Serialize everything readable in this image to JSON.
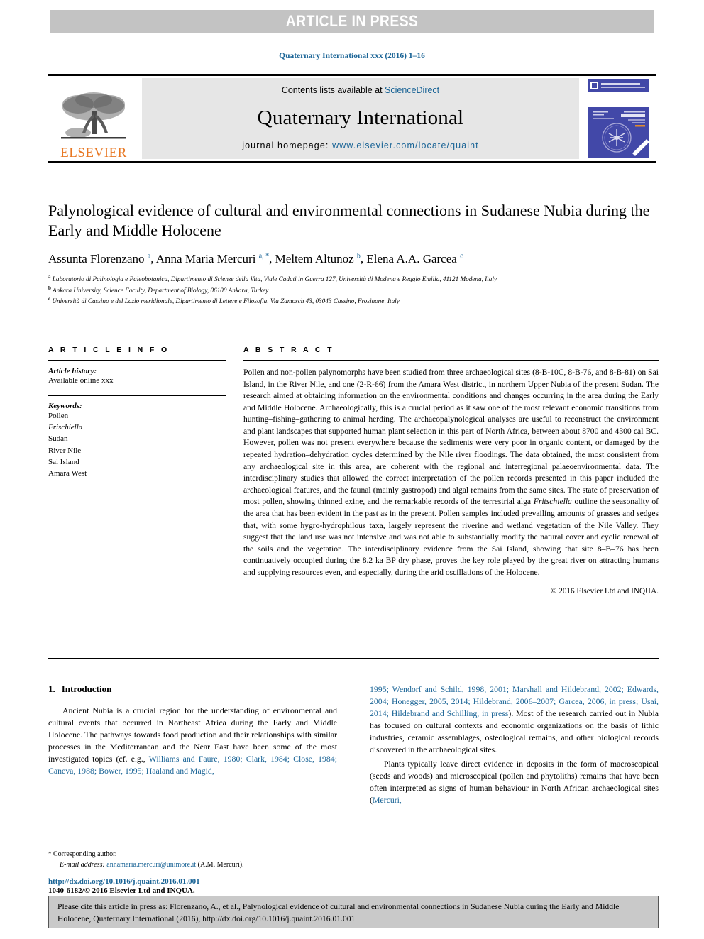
{
  "banner": {
    "label": "ARTICLE IN PRESS"
  },
  "journal_ref": "Quaternary International xxx (2016) 1–16",
  "masthead": {
    "contents_prefix": "Contents lists available at ",
    "sciencedirect": "ScienceDirect",
    "journal_name": "Quaternary International",
    "homepage_prefix": "journal homepage: ",
    "homepage_url": "www.elsevier.com/locate/quaint",
    "publisher": "ELSEVIER",
    "publisher_color": "#E87722",
    "link_color": "#1a6496",
    "cover_icon": "journal-cover-thumbnail",
    "logo_icon": "elsevier-tree-logo"
  },
  "article": {
    "title": "Palynological evidence of cultural and environmental connections in Sudanese Nubia during the Early and Middle Holocene",
    "authors_html": "Assunta Florenzano <sup>a</sup>, Anna Maria Mercuri <sup>a, *</sup>, Meltem Altunoz <sup>b</sup>, Elena A.A. Garcea <sup>c</sup>",
    "affiliations": [
      {
        "mark": "a",
        "text": "Laboratorio di Palinologia e Paleobotanica, Dipartimento di Scienze della Vita, Viale Caduti in Guerra 127, Università di Modena e Reggio Emilia, 41121 Modena, Italy"
      },
      {
        "mark": "b",
        "text": "Ankara University, Science Faculty, Department of Biology, 06100 Ankara, Turkey"
      },
      {
        "mark": "c",
        "text": "Università di Cassino e del Lazio meridionale, Dipartimento di Lettere e Filosofia, Via Zamosch 43, 03043 Cassino, Frosinone, Italy"
      }
    ]
  },
  "article_info": {
    "heading": "A R T I C L E   I N F O",
    "history_label": "Article history:",
    "history_value": "Available online xxx",
    "keywords_label": "Keywords:",
    "keywords": [
      {
        "text": "Pollen",
        "italic": false
      },
      {
        "text": "Frischiella",
        "italic": true
      },
      {
        "text": "Sudan",
        "italic": false
      },
      {
        "text": "River Nile",
        "italic": false
      },
      {
        "text": "Sai Island",
        "italic": false
      },
      {
        "text": "Amara West",
        "italic": false
      }
    ]
  },
  "abstract": {
    "heading": "A B S T R A C T",
    "body_part1": "Pollen and non-pollen palynomorphs have been studied from three archaeological sites (8-B-10C, 8-B-76, and 8-B-81) on Sai Island, in the River Nile, and one (2-R-66) from the Amara West district, in northern Upper Nubia of the present Sudan. The research aimed at obtaining information on the environmental conditions and changes occurring in the area during the Early and Middle Holocene. Archaeologically, this is a crucial period as it saw one of the most relevant economic transitions from hunting–fishing–gathering to animal herding. The archaeopalynological analyses are useful to reconstruct the environment and plant landscapes that supported human plant selection in this part of North Africa, between about 8700 and 4300 cal BC. However, pollen was not present everywhere because the sediments were very poor in organic content, or damaged by the repeated hydration–dehydration cycles determined by the Nile river floodings. The data obtained, the most consistent from any archaeological site in this area, are coherent with the regional and interregional palaeoenvironmental data. The interdisciplinary studies that allowed the correct interpretation of the pollen records presented in this paper included the archaeological features, and the faunal (mainly gastropod) and algal remains from the same sites. The state of preservation of most pollen, showing thinned exine, and the remarkable records of the terrestrial alga ",
    "body_italic": "Fritschiella",
    "body_part2": " outline the seasonality of the area that has been evident in the past as in the present. Pollen samples included prevailing amounts of grasses and sedges that, with some hygro-hydrophilous taxa, largely represent the riverine and wetland vegetation of the Nile Valley. They suggest that the land use was not intensive and was not able to substantially modify the natural cover and cyclic renewal of the soils and the vegetation. The interdisciplinary evidence from the Sai Island, showing that site 8–B–76 has been continuatively occupied during the 8.2 ka BP dry phase, proves the key role played by the great river on attracting humans and supplying resources even, and especially, during the arid oscillations of the Holocene.",
    "copyright": "© 2016 Elsevier Ltd and INQUA."
  },
  "introduction": {
    "number": "1.",
    "heading": "Introduction",
    "para1_a": "Ancient Nubia is a crucial region for the understanding of environmental and cultural events that occurred in Northeast Africa during the Early and Middle Holocene. The pathways towards food production and their relationships with similar processes in the Mediterranean and the Near East have been some of the most investigated topics (cf. e.g., ",
    "para1_refs": "Williams and Faure, 1980; Clark, 1984; Close, 1984; Caneva, 1988; Bower, 1995; Haaland and Magid, 1995; Wendorf and Schild, 1998, 2001; Marshall and Hildebrand, 2002; Edwards, 2004; Honegger, 2005, 2014; Hildebrand, 2006–2007; Garcea, 2006, in press; Usai, 2014; Hildebrand and Schilling, in press",
    "para1_b": "). Most of the research carried out in Nubia has focused on cultural contexts and economic organizations on the basis of lithic industries, ceramic assemblages, osteological remains, and other biological records discovered in the archaeological sites.",
    "para2_a": "Plants typically leave direct evidence in deposits in the form of macroscopical (seeds and woods) and microscopical (pollen and phytoliths) remains that have been often interpreted as signs of human behaviour in North African archaeological sites (",
    "para2_ref": "Mercuri,"
  },
  "footnote": {
    "corresponding": "Corresponding author.",
    "email_label": "E-mail address:",
    "email": "annamaria.mercuri@unimore.it",
    "email_owner": "(A.M. Mercuri)."
  },
  "doi": {
    "url": "http://dx.doi.org/10.1016/j.quaint.2016.01.001",
    "issn_line": "1040-6182/© 2016 Elsevier Ltd and INQUA."
  },
  "cite_box": {
    "text": "Please cite this article in press as: Florenzano, A., et al., Palynological evidence of cultural and environmental connections in Sudanese Nubia during the Early and Middle Holocene, Quaternary International (2016), http://dx.doi.org/10.1016/j.quaint.2016.01.001"
  }
}
